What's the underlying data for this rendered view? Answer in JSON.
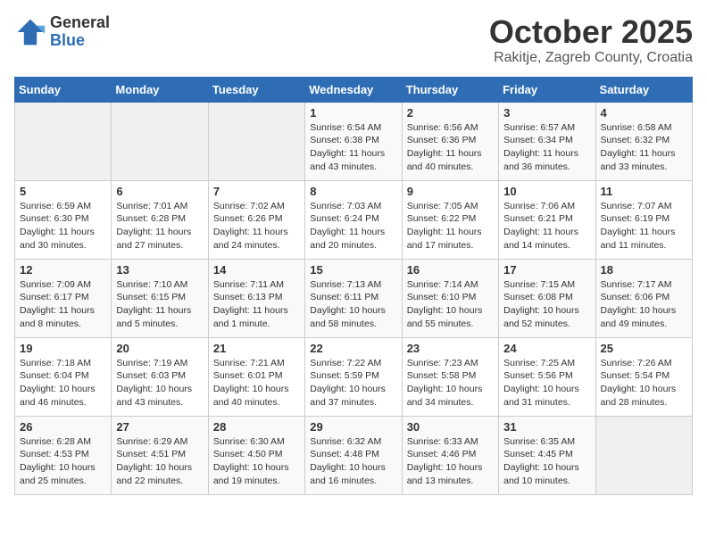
{
  "header": {
    "logo_general": "General",
    "logo_blue": "Blue",
    "title": "October 2025",
    "subtitle": "Rakitje, Zagreb County, Croatia"
  },
  "weekdays": [
    "Sunday",
    "Monday",
    "Tuesday",
    "Wednesday",
    "Thursday",
    "Friday",
    "Saturday"
  ],
  "weeks": [
    [
      {
        "day": "",
        "info": ""
      },
      {
        "day": "",
        "info": ""
      },
      {
        "day": "",
        "info": ""
      },
      {
        "day": "1",
        "info": "Sunrise: 6:54 AM\nSunset: 6:38 PM\nDaylight: 11 hours\nand 43 minutes."
      },
      {
        "day": "2",
        "info": "Sunrise: 6:56 AM\nSunset: 6:36 PM\nDaylight: 11 hours\nand 40 minutes."
      },
      {
        "day": "3",
        "info": "Sunrise: 6:57 AM\nSunset: 6:34 PM\nDaylight: 11 hours\nand 36 minutes."
      },
      {
        "day": "4",
        "info": "Sunrise: 6:58 AM\nSunset: 6:32 PM\nDaylight: 11 hours\nand 33 minutes."
      }
    ],
    [
      {
        "day": "5",
        "info": "Sunrise: 6:59 AM\nSunset: 6:30 PM\nDaylight: 11 hours\nand 30 minutes."
      },
      {
        "day": "6",
        "info": "Sunrise: 7:01 AM\nSunset: 6:28 PM\nDaylight: 11 hours\nand 27 minutes."
      },
      {
        "day": "7",
        "info": "Sunrise: 7:02 AM\nSunset: 6:26 PM\nDaylight: 11 hours\nand 24 minutes."
      },
      {
        "day": "8",
        "info": "Sunrise: 7:03 AM\nSunset: 6:24 PM\nDaylight: 11 hours\nand 20 minutes."
      },
      {
        "day": "9",
        "info": "Sunrise: 7:05 AM\nSunset: 6:22 PM\nDaylight: 11 hours\nand 17 minutes."
      },
      {
        "day": "10",
        "info": "Sunrise: 7:06 AM\nSunset: 6:21 PM\nDaylight: 11 hours\nand 14 minutes."
      },
      {
        "day": "11",
        "info": "Sunrise: 7:07 AM\nSunset: 6:19 PM\nDaylight: 11 hours\nand 11 minutes."
      }
    ],
    [
      {
        "day": "12",
        "info": "Sunrise: 7:09 AM\nSunset: 6:17 PM\nDaylight: 11 hours\nand 8 minutes."
      },
      {
        "day": "13",
        "info": "Sunrise: 7:10 AM\nSunset: 6:15 PM\nDaylight: 11 hours\nand 5 minutes."
      },
      {
        "day": "14",
        "info": "Sunrise: 7:11 AM\nSunset: 6:13 PM\nDaylight: 11 hours\nand 1 minute."
      },
      {
        "day": "15",
        "info": "Sunrise: 7:13 AM\nSunset: 6:11 PM\nDaylight: 10 hours\nand 58 minutes."
      },
      {
        "day": "16",
        "info": "Sunrise: 7:14 AM\nSunset: 6:10 PM\nDaylight: 10 hours\nand 55 minutes."
      },
      {
        "day": "17",
        "info": "Sunrise: 7:15 AM\nSunset: 6:08 PM\nDaylight: 10 hours\nand 52 minutes."
      },
      {
        "day": "18",
        "info": "Sunrise: 7:17 AM\nSunset: 6:06 PM\nDaylight: 10 hours\nand 49 minutes."
      }
    ],
    [
      {
        "day": "19",
        "info": "Sunrise: 7:18 AM\nSunset: 6:04 PM\nDaylight: 10 hours\nand 46 minutes."
      },
      {
        "day": "20",
        "info": "Sunrise: 7:19 AM\nSunset: 6:03 PM\nDaylight: 10 hours\nand 43 minutes."
      },
      {
        "day": "21",
        "info": "Sunrise: 7:21 AM\nSunset: 6:01 PM\nDaylight: 10 hours\nand 40 minutes."
      },
      {
        "day": "22",
        "info": "Sunrise: 7:22 AM\nSunset: 5:59 PM\nDaylight: 10 hours\nand 37 minutes."
      },
      {
        "day": "23",
        "info": "Sunrise: 7:23 AM\nSunset: 5:58 PM\nDaylight: 10 hours\nand 34 minutes."
      },
      {
        "day": "24",
        "info": "Sunrise: 7:25 AM\nSunset: 5:56 PM\nDaylight: 10 hours\nand 31 minutes."
      },
      {
        "day": "25",
        "info": "Sunrise: 7:26 AM\nSunset: 5:54 PM\nDaylight: 10 hours\nand 28 minutes."
      }
    ],
    [
      {
        "day": "26",
        "info": "Sunrise: 6:28 AM\nSunset: 4:53 PM\nDaylight: 10 hours\nand 25 minutes."
      },
      {
        "day": "27",
        "info": "Sunrise: 6:29 AM\nSunset: 4:51 PM\nDaylight: 10 hours\nand 22 minutes."
      },
      {
        "day": "28",
        "info": "Sunrise: 6:30 AM\nSunset: 4:50 PM\nDaylight: 10 hours\nand 19 minutes."
      },
      {
        "day": "29",
        "info": "Sunrise: 6:32 AM\nSunset: 4:48 PM\nDaylight: 10 hours\nand 16 minutes."
      },
      {
        "day": "30",
        "info": "Sunrise: 6:33 AM\nSunset: 4:46 PM\nDaylight: 10 hours\nand 13 minutes."
      },
      {
        "day": "31",
        "info": "Sunrise: 6:35 AM\nSunset: 4:45 PM\nDaylight: 10 hours\nand 10 minutes."
      },
      {
        "day": "",
        "info": ""
      }
    ]
  ]
}
